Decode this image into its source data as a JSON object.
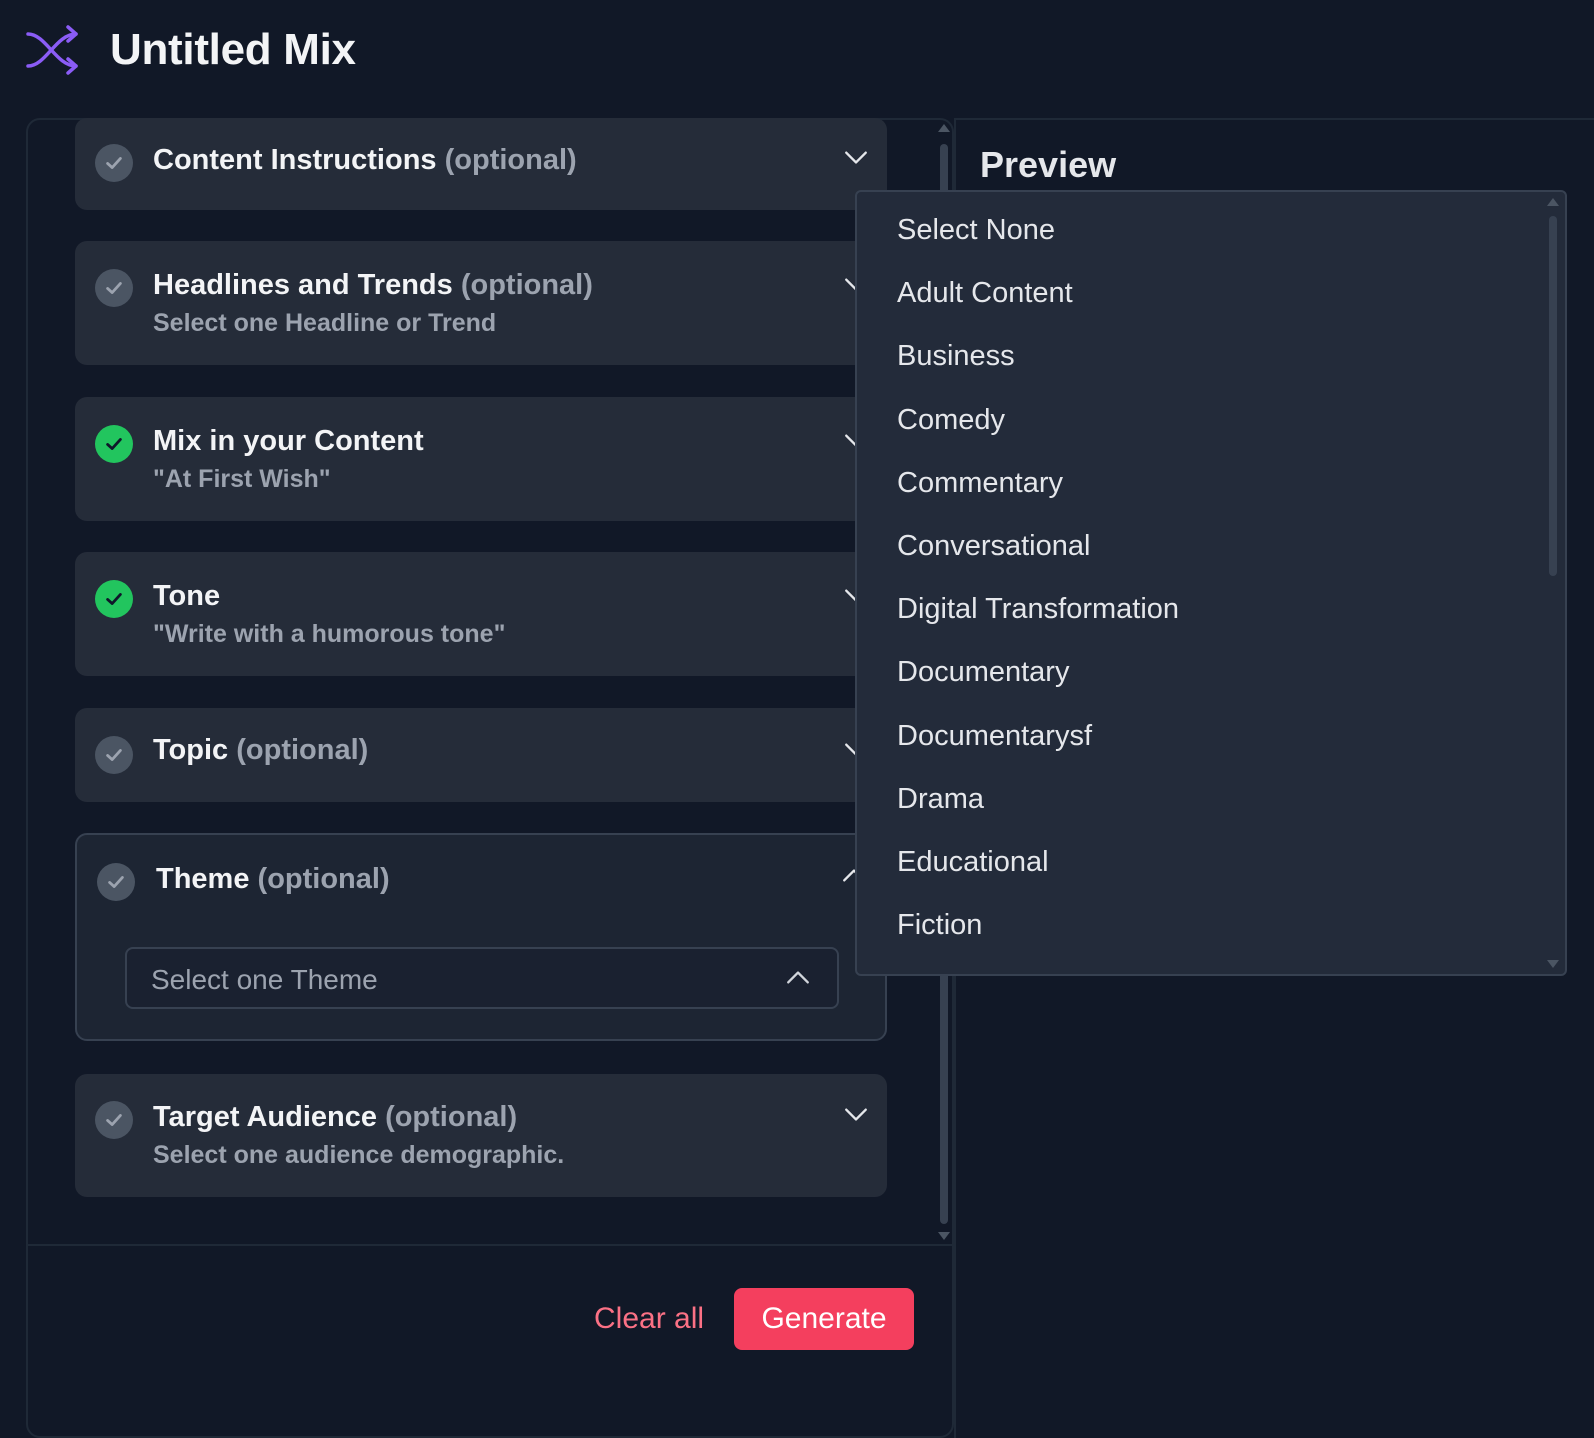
{
  "app": {
    "title": "Untitled Mix",
    "logo_icon": "shuffle-icon",
    "accent_color": "#8b5cf6"
  },
  "sections": [
    {
      "title": "Content Instructions",
      "optional_label": "(optional)",
      "subtitle": "",
      "completed": false,
      "expanded": false
    },
    {
      "title": "Headlines and Trends",
      "optional_label": "(optional)",
      "subtitle": "Select one Headline or Trend",
      "completed": false,
      "expanded": false
    },
    {
      "title": "Mix in your Content",
      "optional_label": "",
      "subtitle": "\"At First Wish\"",
      "completed": true,
      "expanded": false
    },
    {
      "title": "Tone",
      "optional_label": "",
      "subtitle": "\"Write with a humorous tone\"",
      "completed": true,
      "expanded": false
    },
    {
      "title": "Topic",
      "optional_label": "(optional)",
      "subtitle": "",
      "completed": false,
      "expanded": false
    },
    {
      "title": "Theme",
      "optional_label": "(optional)",
      "subtitle": "",
      "completed": false,
      "expanded": true
    },
    {
      "title": "Target Audience",
      "optional_label": "(optional)",
      "subtitle": "Select one audience demographic.",
      "completed": false,
      "expanded": false
    }
  ],
  "theme_select": {
    "placeholder": "Select one Theme",
    "options": [
      "Select None",
      "Adult Content",
      "Business",
      "Comedy",
      "Commentary",
      "Conversational",
      "Digital Transformation",
      "Documentary",
      "Documentarysf",
      "Drama",
      "Educational",
      "Fiction"
    ]
  },
  "preview": {
    "title": "Preview"
  },
  "footer": {
    "clear_label": "Clear all",
    "generate_label": "Generate"
  },
  "colors": {
    "background": "#111827",
    "card": "#252c39",
    "check_done": "#22c55e",
    "check_pending": "#4b5563",
    "primary_button": "#f43f5e",
    "link": "#fb7185"
  }
}
